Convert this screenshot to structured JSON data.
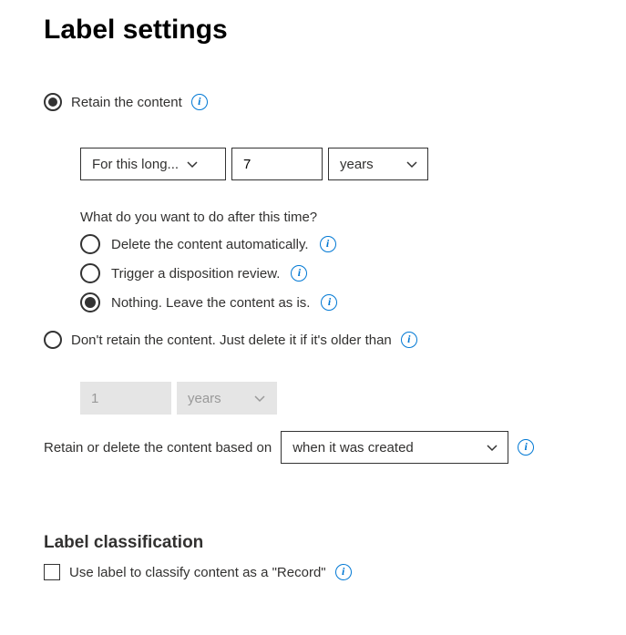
{
  "title": "Label settings",
  "retain": {
    "retain_label": "Retain the content",
    "duration_mode": "For this long...",
    "duration_value": "7",
    "duration_unit": "years",
    "after_question": "What do you want to do after this time?",
    "after_options": {
      "delete": "Delete the content automatically.",
      "review": "Trigger a disposition review.",
      "nothing": "Nothing. Leave the content as is."
    }
  },
  "dont_retain": {
    "label": "Don't retain the content. Just delete it if it's older than",
    "value": "1",
    "unit": "years"
  },
  "based_on": {
    "label": "Retain or delete the content based on",
    "value": "when it was created"
  },
  "classification": {
    "heading": "Label classification",
    "record_label": "Use label to classify content as a \"Record\""
  }
}
